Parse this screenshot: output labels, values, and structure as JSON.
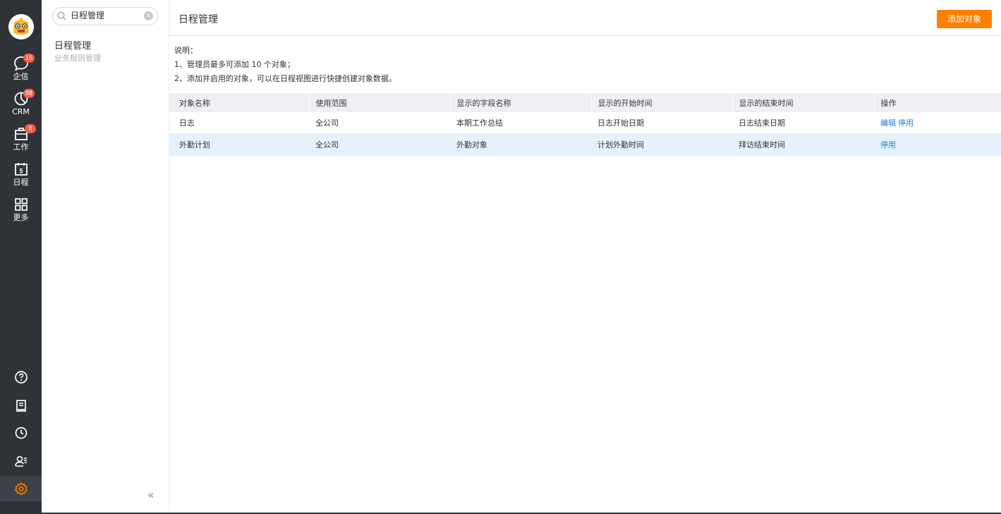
{
  "nav": {
    "items": [
      {
        "label": "企信",
        "badge": "16",
        "icon": "chat-bubble-icon"
      },
      {
        "label": "CRM",
        "badge": "88",
        "icon": "pie-chart-icon"
      },
      {
        "label": "工作",
        "badge": "8",
        "icon": "briefcase-icon"
      },
      {
        "label": "日程",
        "badge": "",
        "icon": "calendar-icon",
        "icon_text": "5"
      },
      {
        "label": "更多",
        "badge": "",
        "icon": "grid-icon"
      }
    ],
    "bottom_icons": [
      "help-icon",
      "notebook-icon",
      "clock-icon",
      "contacts-icon",
      "settings-icon"
    ],
    "active_bottom": "settings-icon",
    "accent_color": "#ff8000"
  },
  "sidebar": {
    "search_value": "日程管理",
    "entry_title": "日程管理",
    "entry_subtitle": "业务规则管理",
    "collapse_glyph": "«"
  },
  "main": {
    "title": "日程管理",
    "add_button": "添加对象",
    "notes": [
      "说明：",
      "1、管理员最多可添加 10 个对象；",
      "2、添加并启用的对象，可以在日程视图进行快捷创建对象数据。"
    ],
    "table": {
      "headers": [
        "对象名称",
        "使用范围",
        "显示的字段名称",
        "显示的开始时间",
        "显示的结束时间",
        "操作"
      ],
      "rows": [
        {
          "name": "日志",
          "scope": "全公司",
          "field": "本期工作总结",
          "start": "日志开始日期",
          "end": "日志结束日期",
          "ops": [
            "编辑",
            "停用"
          ],
          "selected": false
        },
        {
          "name": "外勤计划",
          "scope": "全公司",
          "field": "外勤对象",
          "start": "计划外勤时间",
          "end": "拜访结束时间",
          "ops": [
            "停用"
          ],
          "selected": true
        }
      ]
    }
  }
}
